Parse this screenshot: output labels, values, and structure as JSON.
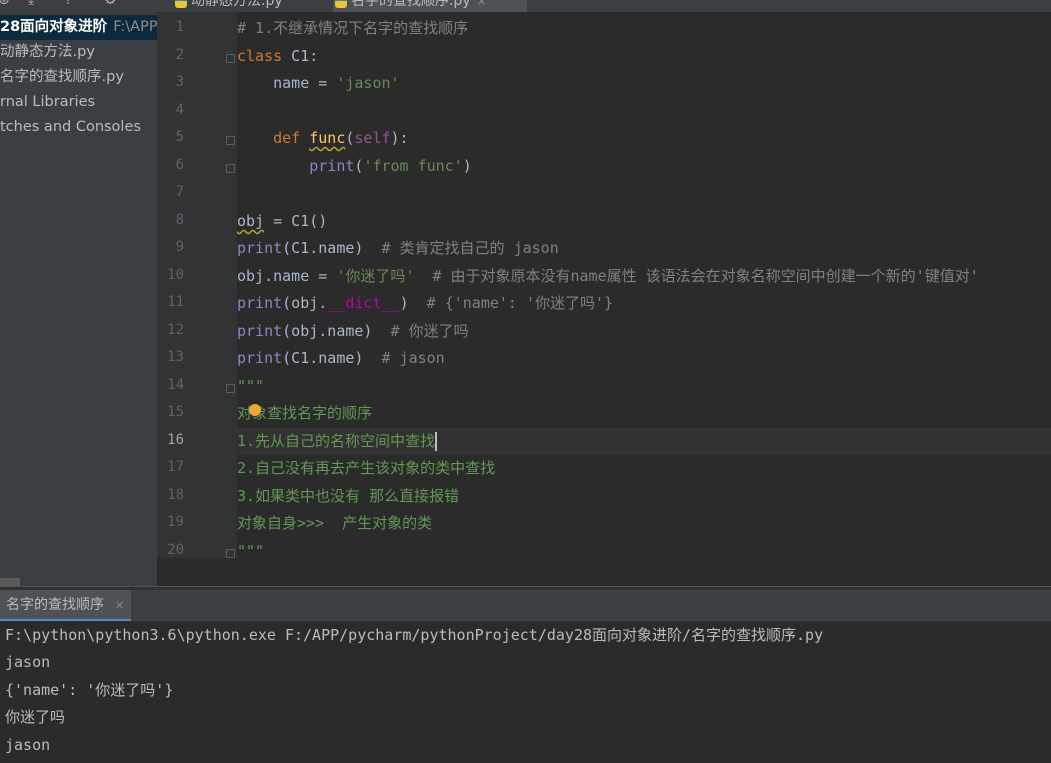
{
  "project": {
    "toolbar_icons": [
      "target-icon",
      "collapse-icon",
      "expand-icon",
      "gear-icon"
    ],
    "root_name": "28面向对象进阶",
    "root_path": "F:\\APP",
    "files": [
      "动静态方法.py",
      "名字的查找顺序.py"
    ],
    "external": "rnal Libraries",
    "scratches": "tches and Consoles"
  },
  "tabs": [
    {
      "label": "动静态方法.py",
      "active": false
    },
    {
      "label": "名字的查找顺序.py",
      "active": true,
      "close": "×"
    }
  ],
  "editor": {
    "current_line": 16,
    "lines": [
      "1",
      "2",
      "3",
      "4",
      "5",
      "6",
      "7",
      "8",
      "9",
      "10",
      "11",
      "12",
      "13",
      "14",
      "15",
      "16",
      "17",
      "18",
      "19",
      "20"
    ],
    "code": {
      "l1": "# 1.不继承情况下名字的查找顺序",
      "l2_kw": "class",
      "l2_rest": " C1:",
      "l3_a": "    name = ",
      "l3_b": "'jason'",
      "l5_kw": "    def ",
      "l5_fn": "func",
      "l5_p1": "(",
      "l5_self": "self",
      "l5_p2": "):",
      "l6_a": "        ",
      "l6_print": "print",
      "l6_b": "(",
      "l6_str": "'from func'",
      "l6_c": ")",
      "l8_obj": "obj",
      "l8_rest": " = C1()",
      "l9_print": "print",
      "l9_rest": "(C1.name)  ",
      "l9_comment": "# 类肯定找自己的 jason",
      "l10_a": "obj.name = ",
      "l10_str": "'你迷了吗'",
      "l10_comment": "  # 由于对象原本没有name属性 该语法会在对象名称空间中创建一个新的'键值对'",
      "l11_print": "print",
      "l11_a": "(obj.",
      "l11_dunder": "__dict__",
      "l11_b": ")  ",
      "l11_comment": "# {'name': '你迷了吗'}",
      "l12_print": "print",
      "l12_rest": "(obj.name)  ",
      "l12_comment": "# 你迷了吗",
      "l13_print": "print",
      "l13_rest": "(C1.name)  ",
      "l13_comment": "# jason",
      "l14": "\"\"\"",
      "l15": "对象查找名字的顺序",
      "l16": "1.先从自己的名称空间中查找",
      "l17": "2.自己没有再去产生该对象的类中查找",
      "l18": "3.如果类中也没有 那么直接报错",
      "l19": "对象自身>>>  产生对象的类",
      "l20": "\"\"\""
    }
  },
  "run": {
    "tab_label": "名字的查找顺序",
    "tab_close": "×",
    "output": [
      "F:\\python\\python3.6\\python.exe F:/APP/pycharm/pythonProject/day28面向对象进阶/名字的查找顺序.py",
      "jason",
      "{'name': '你迷了吗'}",
      "你迷了吗",
      "jason"
    ]
  }
}
